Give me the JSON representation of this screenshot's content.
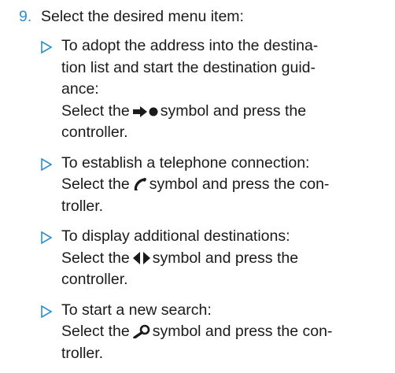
{
  "step": {
    "number": "9.",
    "text": "Select the desired menu item:"
  },
  "accent_color": "#2e8fcf",
  "items": [
    {
      "lines": [
        "To adopt the address into the destina-",
        "tion list and start the destination guid-",
        "ance:"
      ],
      "action_before": "Select the",
      "symbol": "arrow-dot-icon",
      "action_after": "symbol and press the",
      "last_line": "controller."
    },
    {
      "lines": [
        "To establish a telephone connection:"
      ],
      "action_before": "Select the",
      "symbol": "telephone-handset-icon",
      "action_after": "symbol and press the con-",
      "last_line": "troller."
    },
    {
      "lines": [
        "To display additional destinations:"
      ],
      "action_before": "Select the",
      "symbol": "left-right-arrows-icon",
      "action_after": "symbol and press the",
      "last_line": "controller."
    },
    {
      "lines": [
        "To start a new search:"
      ],
      "action_before": "Select the",
      "symbol": "magnifier-icon",
      "action_after": "symbol and press the con-",
      "last_line": "troller."
    }
  ]
}
